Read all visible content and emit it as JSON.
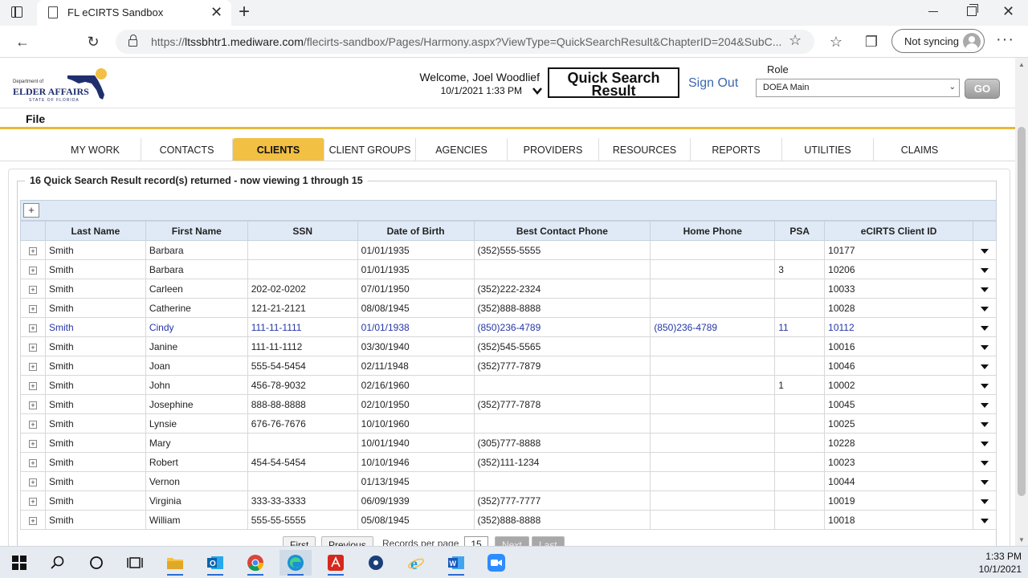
{
  "browser": {
    "tab_title": "FL eCIRTS Sandbox",
    "url_prefix": "https://",
    "url_host": "ltssbhtr1.mediware.com",
    "url_path": "/flecirts-sandbox/Pages/Harmony.aspx?ViewType=QuickSearchResult&ChapterID=204&SubC...",
    "sync_label": "Not syncing"
  },
  "header": {
    "logo": {
      "top": "Department of",
      "main": "ELDER AFFAIRS",
      "sub": "STATE OF FLORIDA"
    },
    "welcome": "Welcome, Joel Woodlief",
    "datetime": "10/1/2021 1:33 PM",
    "page_title": "Quick Search Result",
    "sign_out": "Sign Out",
    "role_label": "Role",
    "role_value": "DOEA Main",
    "go_label": "GO"
  },
  "menu": {
    "file": "File"
  },
  "nav_tabs": [
    {
      "label": "MY WORK",
      "active": false
    },
    {
      "label": "CONTACTS",
      "active": false
    },
    {
      "label": "CLIENTS",
      "active": true
    },
    {
      "label": "CLIENT GROUPS",
      "active": false
    },
    {
      "label": "AGENCIES",
      "active": false
    },
    {
      "label": "PROVIDERS",
      "active": false
    },
    {
      "label": "RESOURCES",
      "active": false
    },
    {
      "label": "REPORTS",
      "active": false
    },
    {
      "label": "UTILITIES",
      "active": false
    },
    {
      "label": "CLAIMS",
      "active": false
    }
  ],
  "results": {
    "summary": "16 Quick Search Result record(s) returned - now viewing 1 through 15",
    "expand_all_label": "+",
    "columns": [
      "Last Name",
      "First Name",
      "SSN",
      "Date of Birth",
      "Best Contact Phone",
      "Home Phone",
      "PSA",
      "eCIRTS Client ID"
    ],
    "rows": [
      [
        "Smith",
        "Barbara",
        "",
        "01/01/1935",
        "(352)555-5555",
        "",
        "",
        "10177"
      ],
      [
        "Smith",
        "Barbara",
        "",
        "01/01/1935",
        "",
        "",
        "3",
        "10206"
      ],
      [
        "Smith",
        "Carleen",
        "202-02-0202",
        "07/01/1950",
        "(352)222-2324",
        "",
        "",
        "10033"
      ],
      [
        "Smith",
        "Catherine",
        "121-21-2121",
        "08/08/1945",
        "(352)888-8888",
        "",
        "",
        "10028"
      ],
      [
        "Smith",
        "Cindy",
        "111-11-1111",
        "01/01/1938",
        "(850)236-4789",
        "(850)236-4789",
        "11",
        "10112"
      ],
      [
        "Smith",
        "Janine",
        "111-11-1112",
        "03/30/1940",
        "(352)545-5565",
        "",
        "",
        "10016"
      ],
      [
        "Smith",
        "Joan",
        "555-54-5454",
        "02/11/1948",
        "(352)777-7879",
        "",
        "",
        "10046"
      ],
      [
        "Smith",
        "John",
        "456-78-9032",
        "02/16/1960",
        "",
        "",
        "1",
        "10002"
      ],
      [
        "Smith",
        "Josephine",
        "888-88-8888",
        "02/10/1950",
        "(352)777-7878",
        "",
        "",
        "10045"
      ],
      [
        "Smith",
        "Lynsie",
        "676-76-7676",
        "10/10/1960",
        "",
        "",
        "",
        "10025"
      ],
      [
        "Smith",
        "Mary",
        "",
        "10/01/1940",
        "(305)777-8888",
        "",
        "",
        "10228"
      ],
      [
        "Smith",
        "Robert",
        "454-54-5454",
        "10/10/1946",
        "(352)111-1234",
        "",
        "",
        "10023"
      ],
      [
        "Smith",
        "Vernon",
        "",
        "01/13/1945",
        "",
        "",
        "",
        "10044"
      ],
      [
        "Smith",
        "Virginia",
        "333-33-3333",
        "06/09/1939",
        "(352)777-7777",
        "",
        "",
        "10019"
      ],
      [
        "Smith",
        "William",
        "555-55-5555",
        "05/08/1945",
        "(352)888-8888",
        "",
        "",
        "10018"
      ]
    ],
    "highlighted_row": 4
  },
  "pager": {
    "first": "First",
    "previous": "Previous",
    "records_per_page_label": "Records per page",
    "records_per_page": "15",
    "next": "Next",
    "last": "Last"
  },
  "taskbar": {
    "time": "1:33 PM",
    "date": "10/1/2021"
  },
  "colors": {
    "active_tab": "#f2c043",
    "accent_line": "#e8b83a",
    "link": "#3a68b0",
    "highlight_row_text": "#2536a8",
    "grid_header": "#e0eaf6"
  }
}
